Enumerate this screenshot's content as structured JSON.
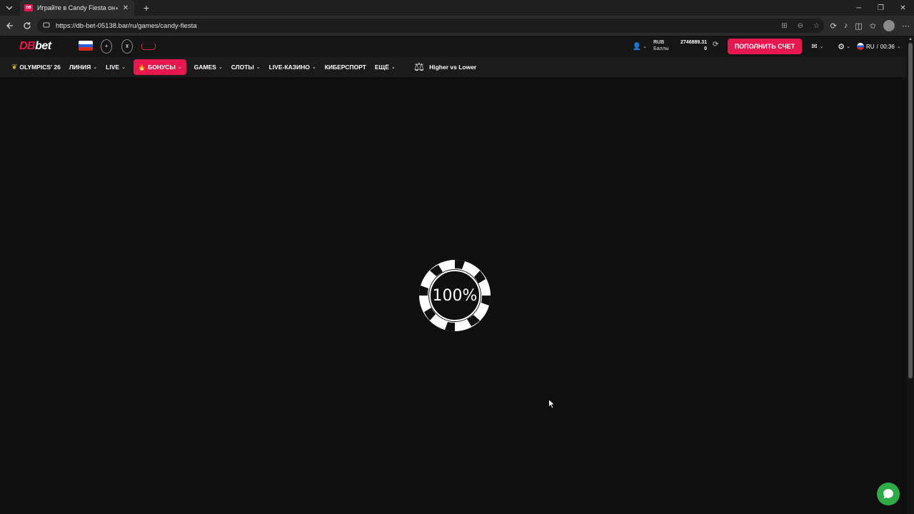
{
  "browser": {
    "tab_title": "Играйте в Candy Fiesta онлайн",
    "favicon_text": "DB",
    "url": "https://db-bet-05138.bar/ru/games/candy-fiesta"
  },
  "header": {
    "logo_db": "DB",
    "logo_bet": "bet",
    "balance_currency": "RUB",
    "balance_amount": "2746889.31",
    "points_label": "Баллы",
    "points_value": "0",
    "deposit_label": "ПОПОЛНИТЬ СЧЕТ",
    "language": "RU",
    "time": "00:36",
    "lang_time_separator": "/"
  },
  "nav": {
    "items": [
      {
        "label": "OLYMPICS' 26"
      },
      {
        "label": "ЛИНИЯ"
      },
      {
        "label": "LIVE"
      },
      {
        "label": "БОНУСЫ"
      },
      {
        "label": "GAMES"
      },
      {
        "label": "СЛОТЫ"
      },
      {
        "label": "LIVE-КАЗИНО"
      },
      {
        "label": "КИБЕРСПОРТ"
      },
      {
        "label": "ЕЩЁ"
      },
      {
        "label": "Higher vs Lower"
      }
    ]
  },
  "loader": {
    "progress_text": "100%",
    "progress": 1.0
  },
  "colors": {
    "brand": "#e8174f",
    "chat": "#2eab46",
    "background": "#0f0f0f"
  }
}
